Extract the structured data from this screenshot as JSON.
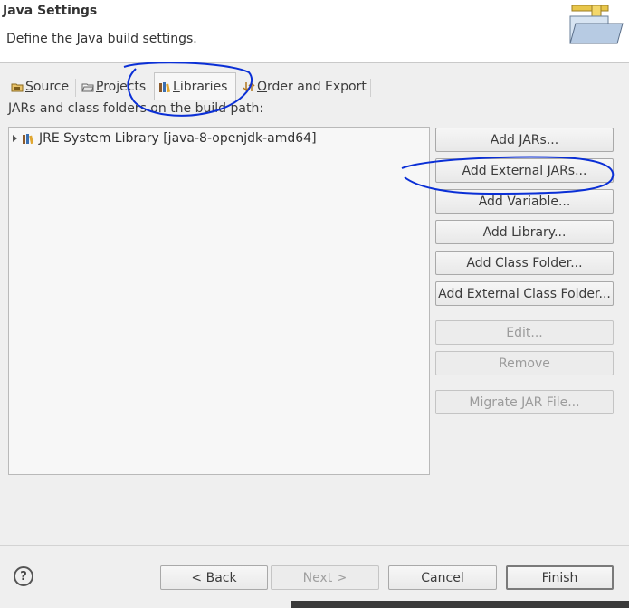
{
  "header": {
    "title": "Java Settings",
    "description": "Define the Java build settings."
  },
  "tabs": [
    {
      "mnemonic": "S",
      "rest": "ource",
      "icon": "source-folder-icon"
    },
    {
      "mnemonic": "P",
      "rest": "rojects",
      "icon": "projects-icon"
    },
    {
      "mnemonic": "L",
      "rest": "ibraries",
      "icon": "libraries-icon",
      "active": true
    },
    {
      "mnemonic": "O",
      "rest": "rder and Export",
      "icon": "order-export-icon"
    }
  ],
  "libraries": {
    "label": "JARs and class folders on the build path:",
    "tree_items": [
      {
        "label": "JRE System Library [java-8-openjdk-amd64]",
        "icon": "library-icon"
      }
    ]
  },
  "buttons": {
    "add_jars": "Add JARs...",
    "add_external_jars": "Add External JARs...",
    "add_variable": "Add Variable...",
    "add_library": "Add Library...",
    "add_class_folder": "Add Class Folder...",
    "add_external_class_folder": "Add External Class Folder...",
    "edit": "Edit...",
    "remove": "Remove",
    "migrate_jar": "Migrate JAR File..."
  },
  "footer": {
    "help": "?",
    "back": "< Back",
    "next": "Next >",
    "cancel": "Cancel",
    "finish": "Finish"
  },
  "colors": {
    "annotation": "#0a2fd6"
  }
}
